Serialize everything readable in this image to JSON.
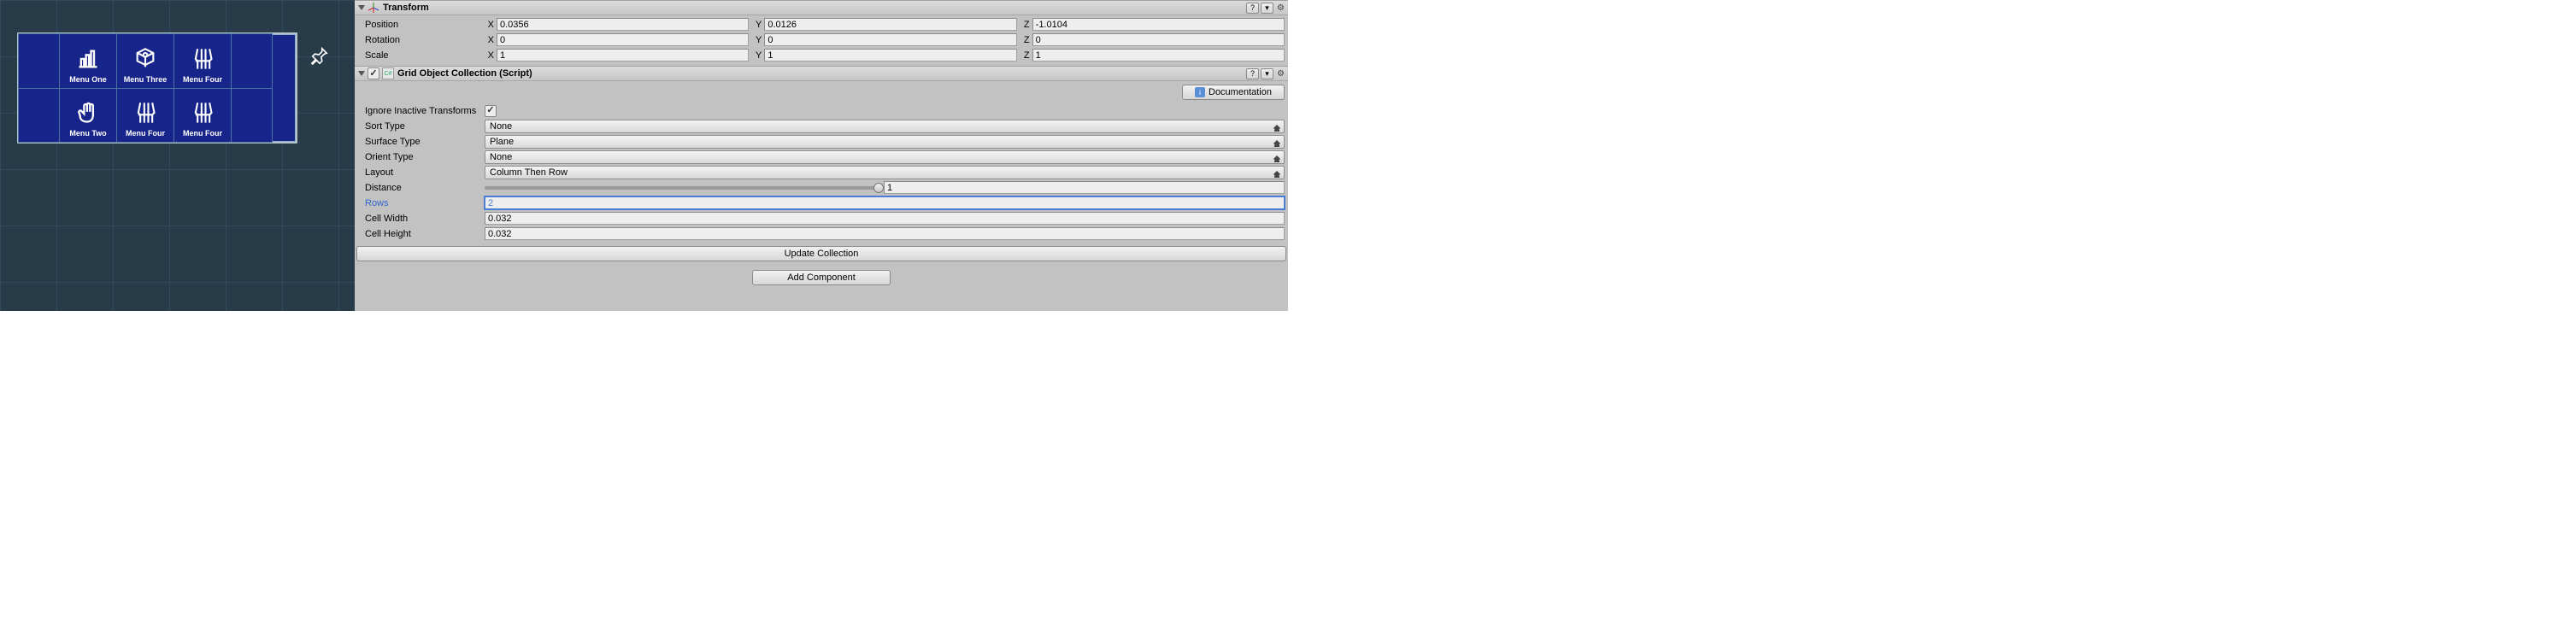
{
  "scene": {
    "tiles": [
      {
        "label": "Menu One",
        "icon": "bar-chart-icon"
      },
      {
        "label": "Menu Three",
        "icon": "camera-box-icon"
      },
      {
        "label": "Menu Four",
        "icon": "hand-skeleton-icon"
      },
      {
        "label": "Menu Two",
        "icon": "hand-icon"
      },
      {
        "label": "Menu Four",
        "icon": "hand-skeleton-icon"
      },
      {
        "label": "Menu Four",
        "icon": "hand-skeleton-icon"
      }
    ]
  },
  "inspector": {
    "transform": {
      "title": "Transform",
      "position": {
        "label": "Position",
        "x": "0.0356",
        "y": "0.0126",
        "z": "-1.0104"
      },
      "rotation": {
        "label": "Rotation",
        "x": "0",
        "y": "0",
        "z": "0"
      },
      "scale": {
        "label": "Scale",
        "x": "1",
        "y": "1",
        "z": "1"
      }
    },
    "gridCollection": {
      "title": "Grid Object Collection (Script)",
      "docBtn": "Documentation",
      "ignoreInactive": {
        "label": "Ignore Inactive Transforms",
        "checked": true
      },
      "sortType": {
        "label": "Sort Type",
        "value": "None"
      },
      "surfaceType": {
        "label": "Surface Type",
        "value": "Plane"
      },
      "orientType": {
        "label": "Orient Type",
        "value": "None"
      },
      "layout": {
        "label": "Layout",
        "value": "Column Then Row"
      },
      "distance": {
        "label": "Distance",
        "value": "1"
      },
      "rows": {
        "label": "Rows",
        "value": "2"
      },
      "cellWidth": {
        "label": "Cell Width",
        "value": "0.032"
      },
      "cellHeight": {
        "label": "Cell Height",
        "value": "0.032"
      },
      "updateBtn": "Update Collection"
    },
    "addComponentBtn": "Add Component"
  }
}
